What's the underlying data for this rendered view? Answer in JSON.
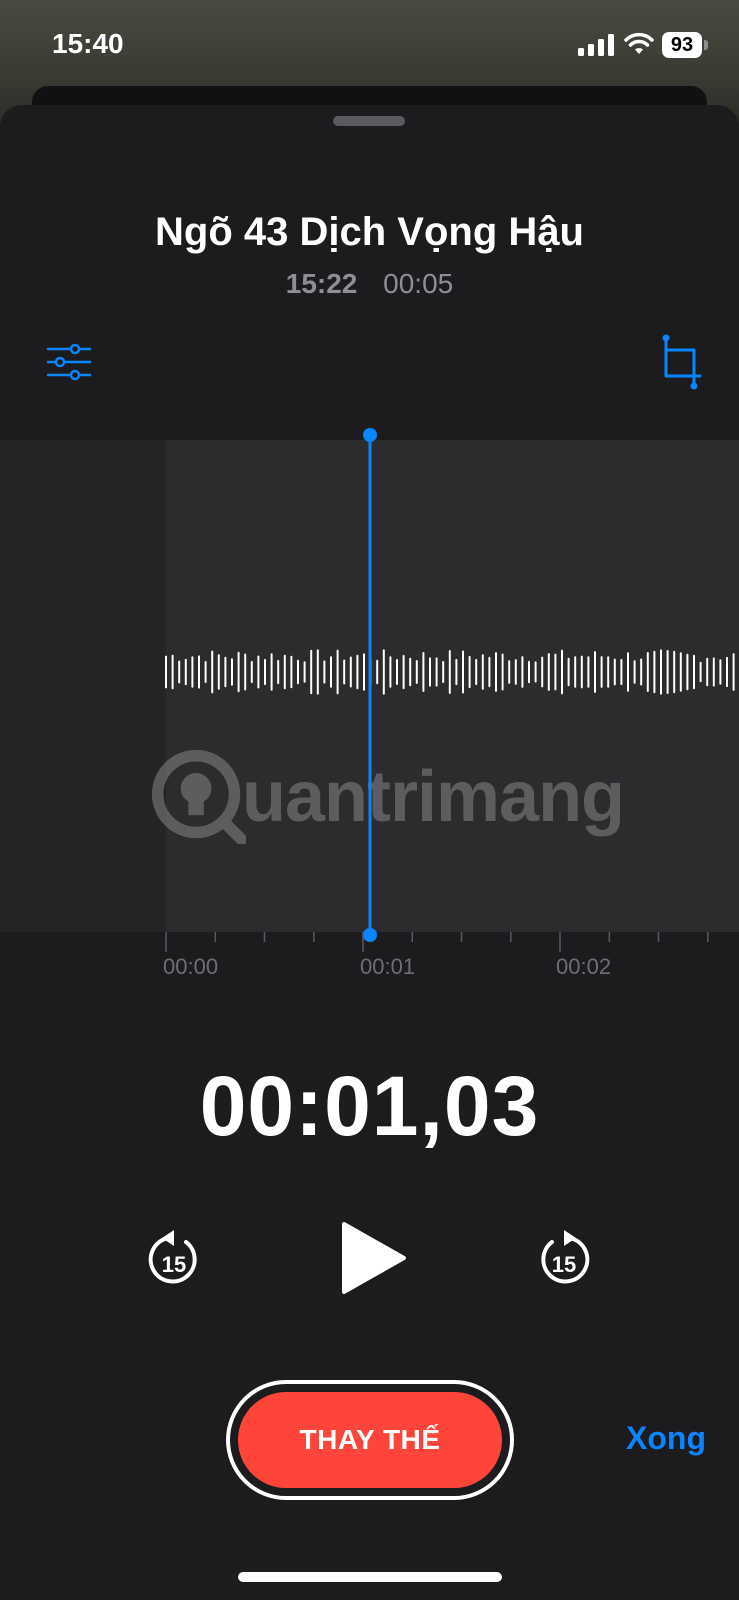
{
  "status_bar": {
    "time": "15:40",
    "battery_level": "93",
    "icons": [
      "signal-icon",
      "wifi-icon",
      "battery-icon"
    ]
  },
  "recording": {
    "title": "Ngõ 43 Dịch Vọng Hậu",
    "recorded_at": "15:22",
    "duration": "00:05"
  },
  "toolbar": {
    "left_icon": "filters-icon",
    "right_icon": "crop-icon"
  },
  "timeline": {
    "tick_labels": [
      "00:00",
      "00:01",
      "00:02"
    ]
  },
  "watermark": {
    "text": "uantrimang"
  },
  "playback": {
    "current_time": "00:01,03",
    "skip_back_seconds": "15",
    "skip_forward_seconds": "15"
  },
  "actions": {
    "replace_label": "THAY THẾ",
    "done_label": "Xong"
  },
  "colors": {
    "accent": "#0a84ff",
    "record_red": "#ff453a",
    "background": "#1c1c1e",
    "wave_selected": "#2c2c2f"
  }
}
